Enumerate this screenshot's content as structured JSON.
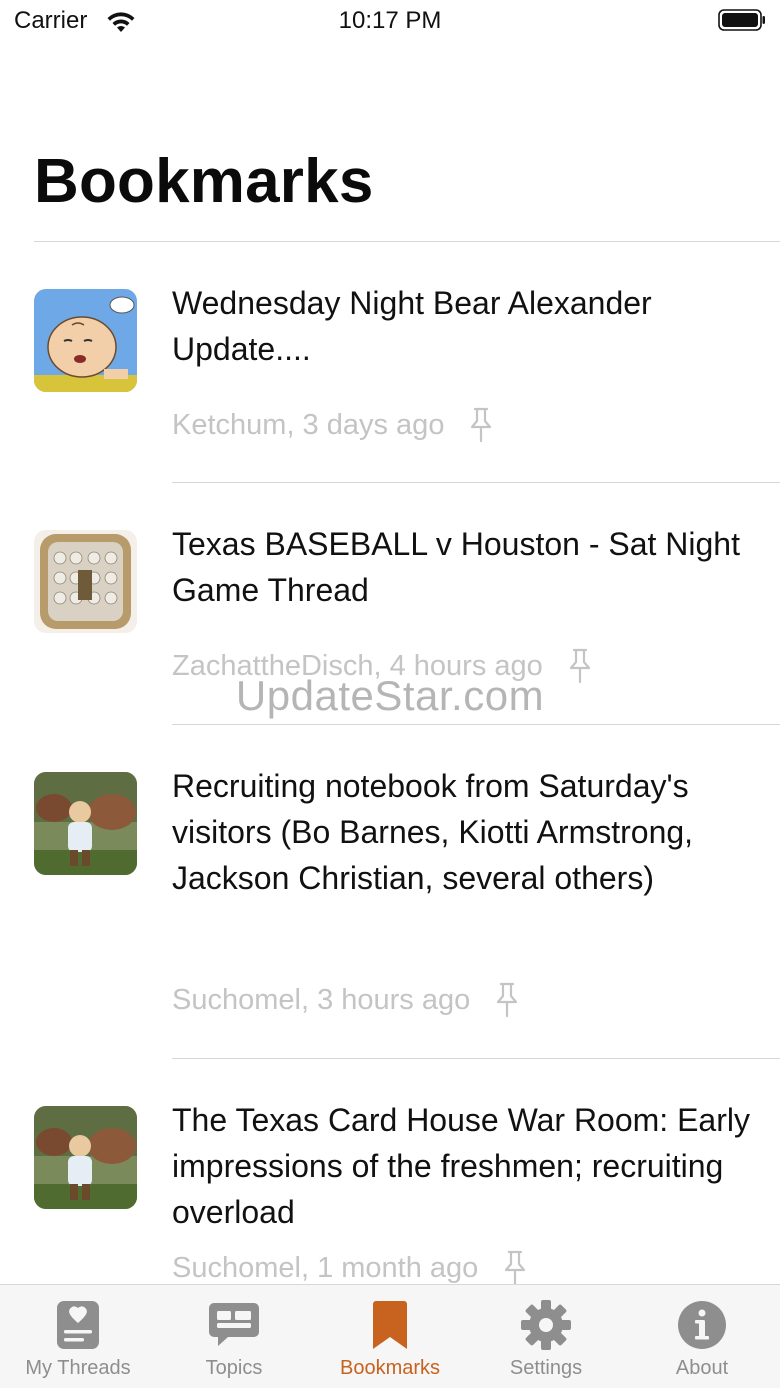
{
  "status_bar": {
    "carrier": "Carrier",
    "time": "10:17 PM"
  },
  "header": {
    "title": "Bookmarks"
  },
  "threads": [
    {
      "title": "Wednesday Night Bear Alexander Update....",
      "meta": "Ketchum, 3 days ago",
      "avatar": "charlie-brown-avatar"
    },
    {
      "title": "Texas BASEBALL v Houston - Sat Night Game Thread",
      "meta": "ZachattheDisch, 4 hours ago",
      "avatar": "championship-ring-avatar"
    },
    {
      "title": "Recruiting notebook from Saturday's visitors (Bo Barnes, Kiotti Armstrong, Jackson Christian, several others)",
      "meta": "Suchomel, 3 hours ago",
      "avatar": "child-with-cattle-avatar"
    },
    {
      "title": "The Texas Card House War Room: Early impressions of the freshmen; recruiting overload",
      "meta": "Suchomel, 1 month ago",
      "avatar": "child-with-cattle-avatar"
    }
  ],
  "watermark": "UpdateStar.com",
  "tab_bar": {
    "tabs": [
      {
        "label": "My Threads",
        "icon": "my-threads-icon"
      },
      {
        "label": "Topics",
        "icon": "topics-icon"
      },
      {
        "label": "Bookmarks",
        "icon": "bookmark-icon",
        "active": true
      },
      {
        "label": "Settings",
        "icon": "gear-icon"
      },
      {
        "label": "About",
        "icon": "info-icon"
      }
    ],
    "active_color": "#c8621f",
    "inactive_color": "#8e8e8e"
  }
}
